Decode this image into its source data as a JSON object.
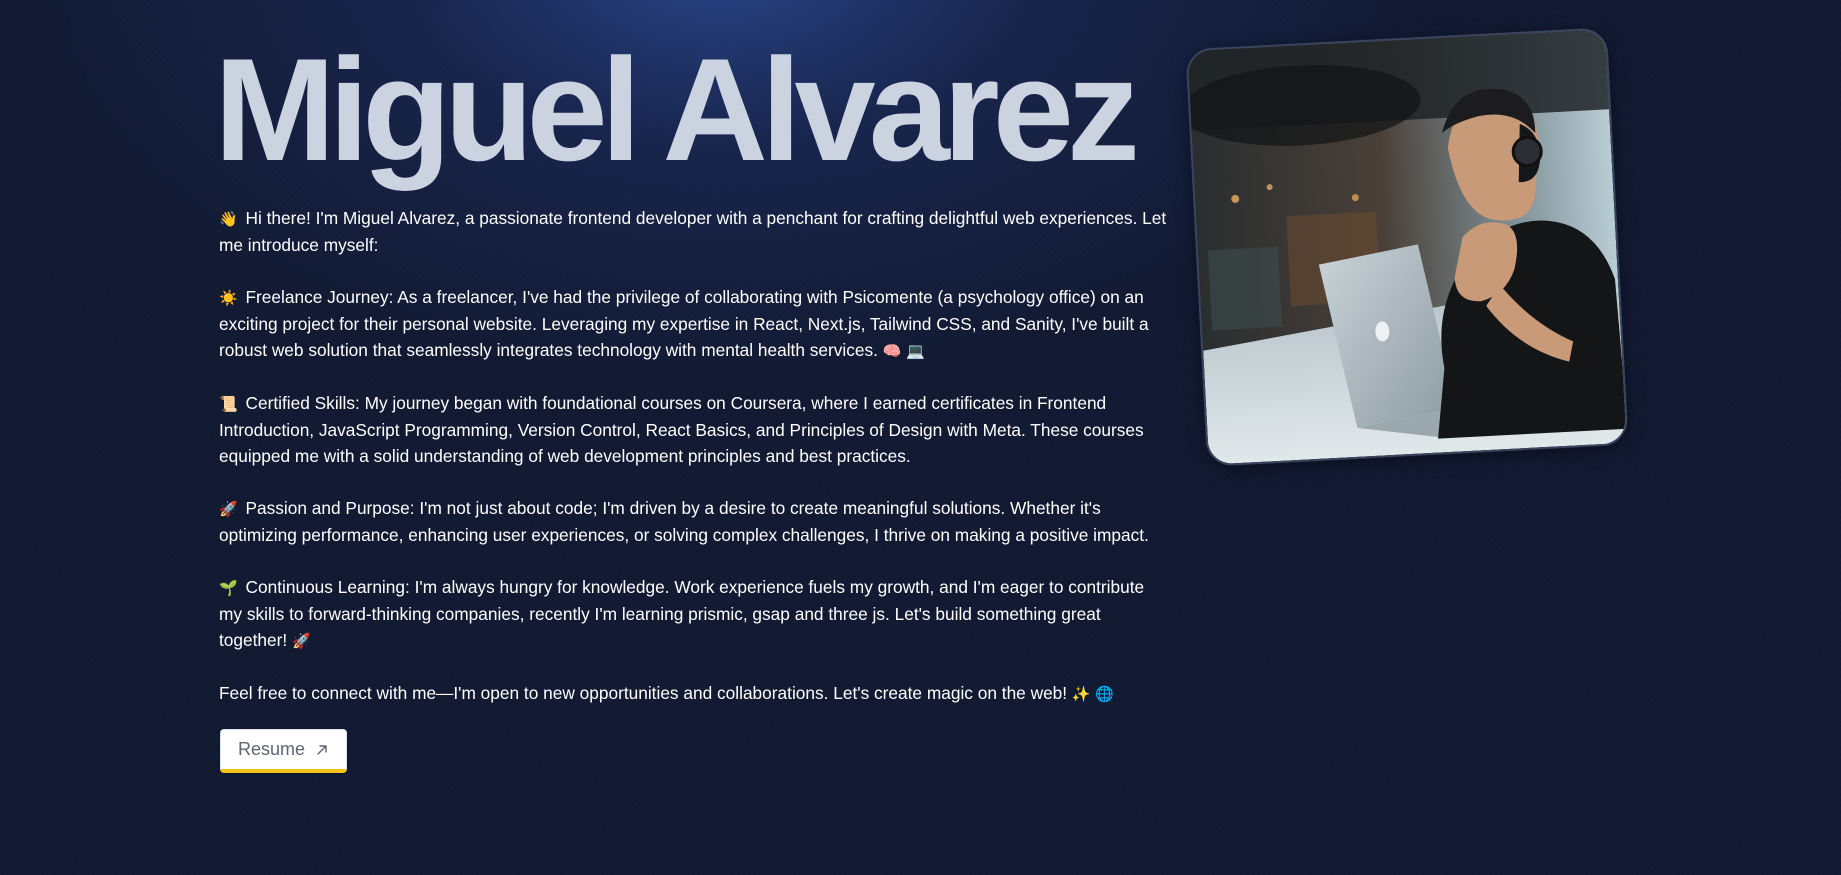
{
  "profile": {
    "name": "Miguel Alvarez",
    "photo_alt": "Miguel Alvarez"
  },
  "bio": {
    "intro": {
      "emoji": "👋",
      "text": "Hi there! I'm Miguel Alvarez, a passionate frontend developer with a penchant for crafting delightful web experiences. Let me introduce myself:"
    },
    "freelance": {
      "emoji": "☀️",
      "text": "Freelance Journey: As a freelancer, I've had the privilege of collaborating with Psicomente (a psychology office) on an exciting project for their personal website. Leveraging my expertise in React, Next.js, Tailwind CSS, and Sanity, I've built a robust web solution that seamlessly integrates technology with mental health services.",
      "trailing_emoji": "🧠 💻"
    },
    "skills": {
      "emoji": "📜",
      "text": "Certified Skills: My journey began with foundational courses on Coursera, where I earned certificates in Frontend Introduction, JavaScript Programming, Version Control, React Basics, and Principles of Design with Meta. These courses equipped me with a solid understanding of web development principles and best practices."
    },
    "passion": {
      "emoji": "🚀",
      "text": "Passion and Purpose: I'm not just about code; I'm driven by a desire to create meaningful solutions. Whether it's optimizing performance, enhancing user experiences, or solving complex challenges, I thrive on making a positive impact."
    },
    "learning": {
      "emoji": "🌱",
      "text": "Continuous Learning: I'm always hungry for knowledge. Work experience fuels my growth, and I'm eager to contribute my skills to forward-thinking companies, recently I'm learning prismic, gsap and three js. Let's build something great together!",
      "trailing_emoji": "🚀"
    },
    "closing": {
      "text": "Feel free to connect with me—I'm open to new opportunities and collaborations. Let's create magic on the web!",
      "trailing_emoji": "✨ 🌐"
    }
  },
  "resume_button": {
    "label": "Resume",
    "icon": "arrow-up-right-icon"
  },
  "colors": {
    "background": "#121a33",
    "name_text": "#cbd3e1",
    "button_accent": "#f2c21a"
  }
}
